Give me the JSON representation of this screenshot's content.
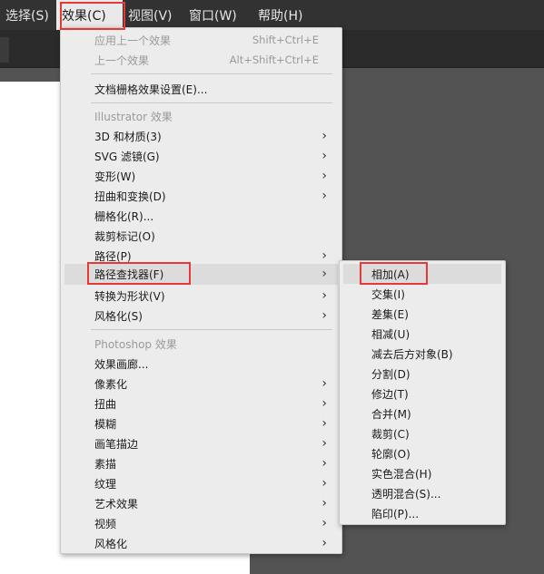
{
  "menubar": {
    "items": [
      {
        "label": "选择(S)"
      },
      {
        "label": "效果(C)"
      },
      {
        "label": "视图(V)"
      },
      {
        "label": "窗口(W)"
      },
      {
        "label": "帮助(H)"
      }
    ]
  },
  "effect_menu": {
    "apply_last": {
      "label": "应用上一个效果",
      "shortcut": "Shift+Ctrl+E"
    },
    "last_effect": {
      "label": "上一个效果",
      "shortcut": "Alt+Shift+Ctrl+E"
    },
    "doc_raster": {
      "label": "文档栅格效果设置(E)..."
    },
    "illustrator_header": "Illustrator 效果",
    "illustrator_items": [
      {
        "label": "3D 和材质(3)",
        "submenu": true
      },
      {
        "label": "SVG 滤镜(G)",
        "submenu": true
      },
      {
        "label": "变形(W)",
        "submenu": true
      },
      {
        "label": "扭曲和变换(D)",
        "submenu": true
      },
      {
        "label": "栅格化(R)...",
        "submenu": false
      },
      {
        "label": "裁剪标记(O)",
        "submenu": false
      },
      {
        "label": "路径(P)",
        "submenu": true
      },
      {
        "label": "路径查找器(F)",
        "submenu": true
      },
      {
        "label": "转换为形状(V)",
        "submenu": true
      },
      {
        "label": "风格化(S)",
        "submenu": true
      }
    ],
    "photoshop_header": "Photoshop 效果",
    "photoshop_items": [
      {
        "label": "效果画廊...",
        "submenu": false
      },
      {
        "label": "像素化",
        "submenu": true
      },
      {
        "label": "扭曲",
        "submenu": true
      },
      {
        "label": "模糊",
        "submenu": true
      },
      {
        "label": "画笔描边",
        "submenu": true
      },
      {
        "label": "素描",
        "submenu": true
      },
      {
        "label": "纹理",
        "submenu": true
      },
      {
        "label": "艺术效果",
        "submenu": true
      },
      {
        "label": "视频",
        "submenu": true
      },
      {
        "label": "风格化",
        "submenu": true
      }
    ],
    "submenu_arrow": "›"
  },
  "pathfinder_menu": {
    "items": [
      {
        "label": "相加(A)"
      },
      {
        "label": "交集(I)"
      },
      {
        "label": "差集(E)"
      },
      {
        "label": "相减(U)"
      },
      {
        "label": "减去后方对象(B)"
      },
      {
        "label": "分割(D)"
      },
      {
        "label": "修边(T)"
      },
      {
        "label": "合并(M)"
      },
      {
        "label": "裁剪(C)"
      },
      {
        "label": "轮廓(O)"
      },
      {
        "label": "实色混合(H)"
      },
      {
        "label": "透明混合(S)..."
      },
      {
        "label": "陷印(P)..."
      }
    ]
  },
  "colors": {
    "menubar_bg": "#323232",
    "menu_bg": "#ececec",
    "highlight": "#dcdcdc",
    "annotation_red": "#e53935"
  }
}
